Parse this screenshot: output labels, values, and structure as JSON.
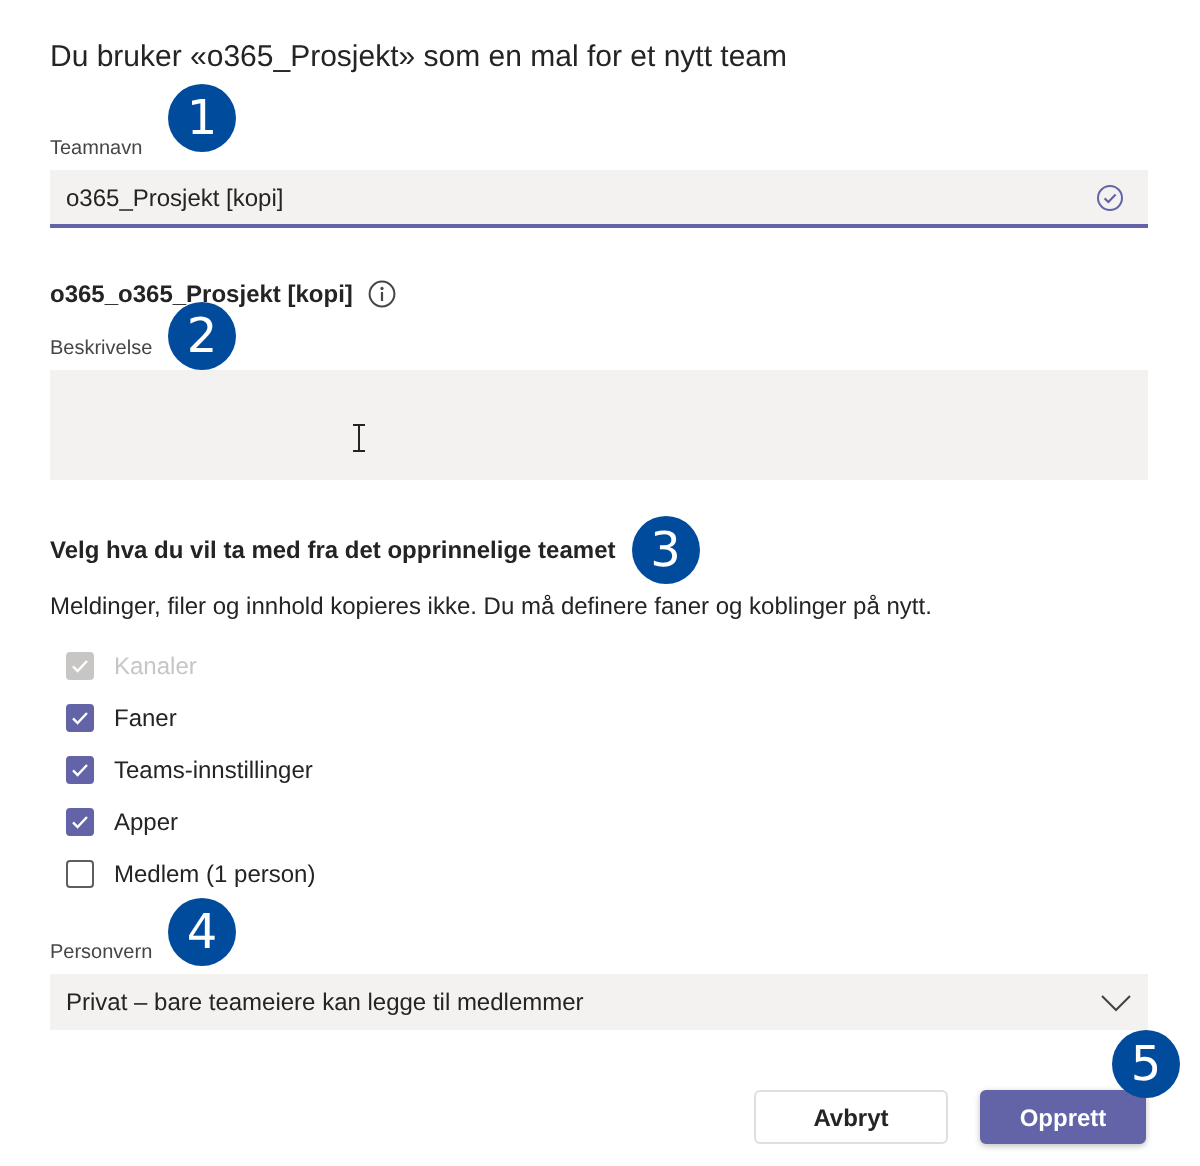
{
  "title": "Du bruker «o365_Prosjekt» som en mal for et nytt team",
  "team_name": {
    "label": "Teamnavn",
    "value": "o365_Prosjekt [kopi]",
    "valid": true,
    "callout": "1"
  },
  "generated_name": "o365_o365_Prosjekt [kopi]",
  "description": {
    "label": "Beskrivelse",
    "callout": "2"
  },
  "copy_section": {
    "heading": "Velg hva du vil ta med fra det opprinnelige teamet",
    "callout": "3",
    "note": "Meldinger, filer og innhold kopieres ikke. Du må definere faner og koblinger på nytt.",
    "options": [
      {
        "label": "Kanaler",
        "checked": true,
        "disabled": true
      },
      {
        "label": "Faner",
        "checked": true,
        "disabled": false
      },
      {
        "label": "Teams-innstillinger",
        "checked": true,
        "disabled": false
      },
      {
        "label": "Apper",
        "checked": true,
        "disabled": false
      },
      {
        "label": "Medlem (1 person)",
        "checked": false,
        "disabled": false
      }
    ]
  },
  "privacy": {
    "label": "Personvern",
    "value": "Privat – bare teameiere kan legge til medlemmer",
    "callout": "4"
  },
  "buttons": [
    {
      "label": "Avbryt",
      "kind": "secondary"
    },
    {
      "label": "Opprett",
      "kind": "primary",
      "callout": "5"
    }
  ]
}
